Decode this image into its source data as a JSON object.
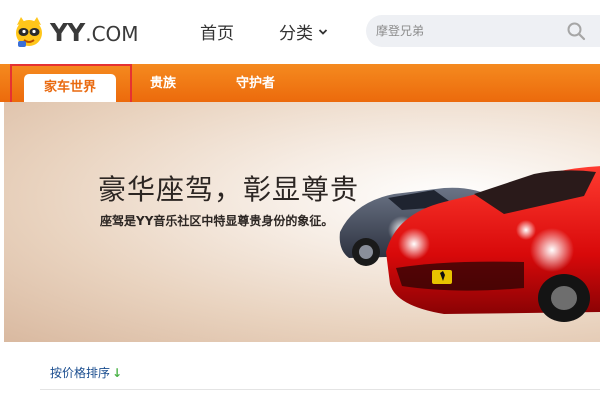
{
  "header": {
    "logo_text_main": "YY",
    "logo_text_suffix": ".COM",
    "nav_home": "首页",
    "nav_category": "分类",
    "search_placeholder": "摩登兄弟"
  },
  "tabs": [
    {
      "label": "家车世界",
      "active": true
    },
    {
      "label": "贵族",
      "active": false
    },
    {
      "label": "守护者",
      "active": false
    }
  ],
  "banner": {
    "title": "豪华座驾，彰显尊贵",
    "subtitle": "座驾是YY音乐社区中特显尊贵身份的象征。"
  },
  "sort": {
    "label": "按价格排序",
    "arrow": "↓"
  },
  "colors": {
    "tab_bar": "#ec6a0c",
    "active_tab_text": "#e96a10",
    "highlight_border": "#e53232",
    "sort_link": "#1a4d8f",
    "sort_arrow": "#4cb348"
  },
  "icons": {
    "logo": "yy-mascot-icon",
    "category_toggle": "chevron-down-icon",
    "search": "search-icon"
  }
}
